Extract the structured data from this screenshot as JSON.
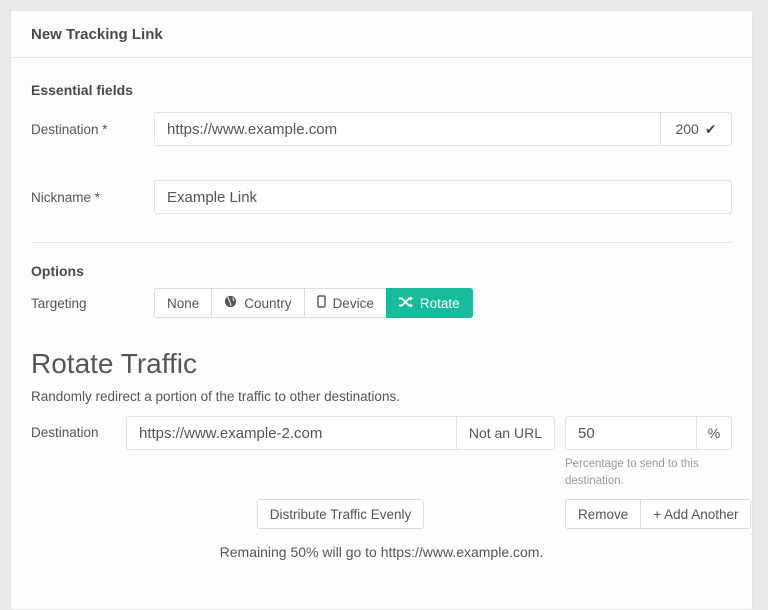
{
  "panel": {
    "title": "New Tracking Link"
  },
  "essential": {
    "heading": "Essential fields",
    "destination": {
      "label": "Destination *",
      "value": "https://www.example.com",
      "status_code": "200",
      "status_icon": "check-icon",
      "check_glyph": "✔"
    },
    "nickname": {
      "label": "Nickname *",
      "value": "Example Link"
    }
  },
  "options": {
    "heading": "Options",
    "targeting": {
      "label": "Targeting",
      "buttons": [
        {
          "label": "None",
          "icon": "none",
          "selected": false
        },
        {
          "label": "Country",
          "icon": "globe-icon",
          "selected": false
        },
        {
          "label": "Device",
          "icon": "device-icon",
          "selected": false
        },
        {
          "label": "Rotate",
          "icon": "shuffle-icon",
          "selected": true
        }
      ]
    }
  },
  "rotate": {
    "heading": "Rotate Traffic",
    "description": "Randomly redirect a portion of the traffic to other destinations.",
    "destination": {
      "label": "Destination",
      "value": "https://www.example-2.com",
      "addon": "Not an URL"
    },
    "percent": {
      "value": "50",
      "addon": "%",
      "help": "Percentage to send to this destination."
    },
    "distribute_button": "Distribute Traffic Evenly",
    "remove_button": "Remove",
    "add_button": "+ Add Another",
    "remaining_note": "Remaining 50% will go to https://www.example.com."
  },
  "colors": {
    "accent": "#18bc9c",
    "panel_bg": "#fdfdfd",
    "page_bg": "#e9e9e9"
  }
}
